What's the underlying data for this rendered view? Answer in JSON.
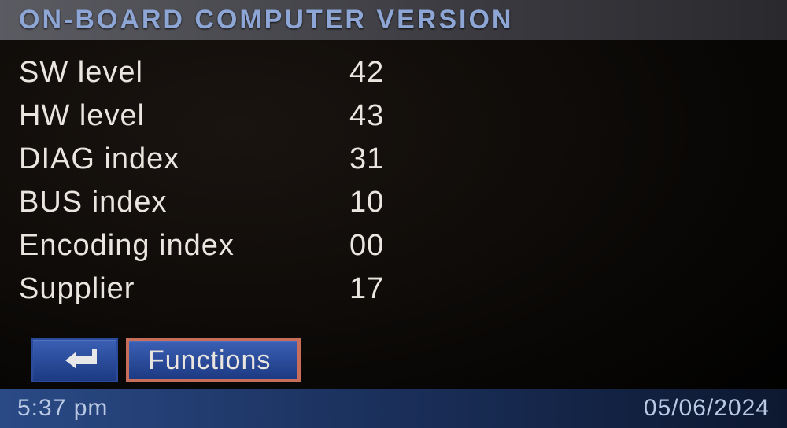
{
  "header": {
    "title": "ON-BOARD COMPUTER VERSION"
  },
  "rows": [
    {
      "label": "SW level",
      "value": "42"
    },
    {
      "label": "HW level",
      "value": "43"
    },
    {
      "label": "DIAG index",
      "value": "31"
    },
    {
      "label": "BUS index",
      "value": "10"
    },
    {
      "label": "Encoding index",
      "value": "00"
    },
    {
      "label": "Supplier",
      "value": "17"
    }
  ],
  "buttons": {
    "back_icon": "return-icon",
    "functions_label": "Functions"
  },
  "footer": {
    "time": "5:37 pm",
    "date": "05/06/2024"
  }
}
